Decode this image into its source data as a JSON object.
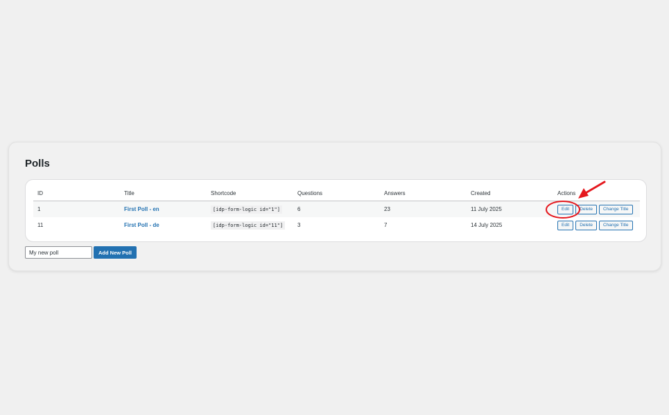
{
  "page": {
    "title": "Polls"
  },
  "table": {
    "headers": {
      "id": "ID",
      "title": "Title",
      "shortcode": "Shortcode",
      "questions": "Questions",
      "answers": "Answers",
      "created": "Created",
      "actions": "Actions"
    },
    "rows": [
      {
        "id": "1",
        "title": "First Poll - en",
        "shortcode": "[idp-form-logic id=\"1\"]",
        "questions": "6",
        "answers": "23",
        "created": "11 July 2025"
      },
      {
        "id": "11",
        "title": "First Poll - de",
        "shortcode": "[idp-form-logic id=\"11\"]",
        "questions": "3",
        "answers": "7",
        "created": "14 July 2025"
      }
    ],
    "action_labels": {
      "edit": "Edit",
      "delete": "Delete",
      "change_title": "Change Title"
    }
  },
  "new_poll": {
    "input_value": "My new poll",
    "button_label": "Add New Poll"
  },
  "annotation": {
    "color": "#e5181e",
    "circle_target": "edit-button-row-1",
    "arrow": "red-arrow-icon"
  },
  "colors": {
    "accent": "#2271b1",
    "background": "#f0f0f0"
  }
}
